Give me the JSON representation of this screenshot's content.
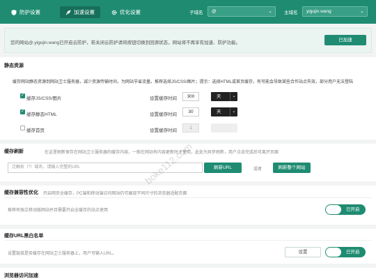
{
  "topbar": {
    "tabs": [
      {
        "label": "防护设置",
        "icon": "shield-icon"
      },
      {
        "label": "加速设置",
        "icon": "rocket-icon"
      },
      {
        "label": "优化设置",
        "icon": "gear-icon"
      }
    ],
    "subdomain_label": "子域名",
    "subdomain_value": "@",
    "main_domain_label": "主域名",
    "main_domain_value": "yigujin.wang"
  },
  "notice": {
    "text": "您的网站@.yigujin.wang已开启云防护，若关闭云防护请将按钮切换到回源状态，网站将不再享有加速、防护功能。",
    "button": "已加速"
  },
  "static": {
    "title": "静态资源",
    "desc": "缓存网站静态资源到网站卫士服务器，减少资源传输时间，为网站节省流量。推荐选择JS/CSS/图片；提示：选择HTML或首页缓存，有可能会导致某些合作站点失效，部分用户无法登陆",
    "rows": [
      {
        "label": "缓存JS/CSS/图片",
        "checked": true,
        "time_label": "设置缓存时间",
        "value": "300",
        "unit": "天",
        "enabled": true
      },
      {
        "label": "缓存静态HTML",
        "checked": true,
        "time_label": "设置缓存时间",
        "value": "30",
        "unit": "天",
        "enabled": true
      },
      {
        "label": "缓存首页",
        "checked": false,
        "time_label": "设置缓存时间",
        "value": "1",
        "unit": "",
        "enabled": false
      }
    ]
  },
  "refresh": {
    "title": "缓存刷新",
    "desc": "在这里刷新保存在网站卫士服务器的缓存内容，一般在网站有内容更新时才使用，此处为异步刷新，用户点击完成后可离开页面",
    "placeholder": "泛解析（*）域名，请输入完整的URL",
    "refresh_url": "刷新URL",
    "or": "或者",
    "refresh_all": "刷新整个网站"
  },
  "compat": {
    "title": "缓存兼容性优化",
    "desc": "开启网页全缓存，PC端和移动端访问网站仍可展现不同尺寸的浏览器适配页面",
    "hint": "推荐有独立移动版网站并且需要开启全缓存的站点使用",
    "toggle": "已开启"
  },
  "whitelist": {
    "title": "缓存URL黑白名单",
    "hint": "设置链接是否缓存在网站卫士服务器上，用户可输入URL。",
    "setting": "设置",
    "toggle": "已开启"
  },
  "browser": {
    "title": "浏览器访问加速"
  },
  "watermark": "boke112.com",
  "colors": {
    "accent": "#1f8c72"
  }
}
